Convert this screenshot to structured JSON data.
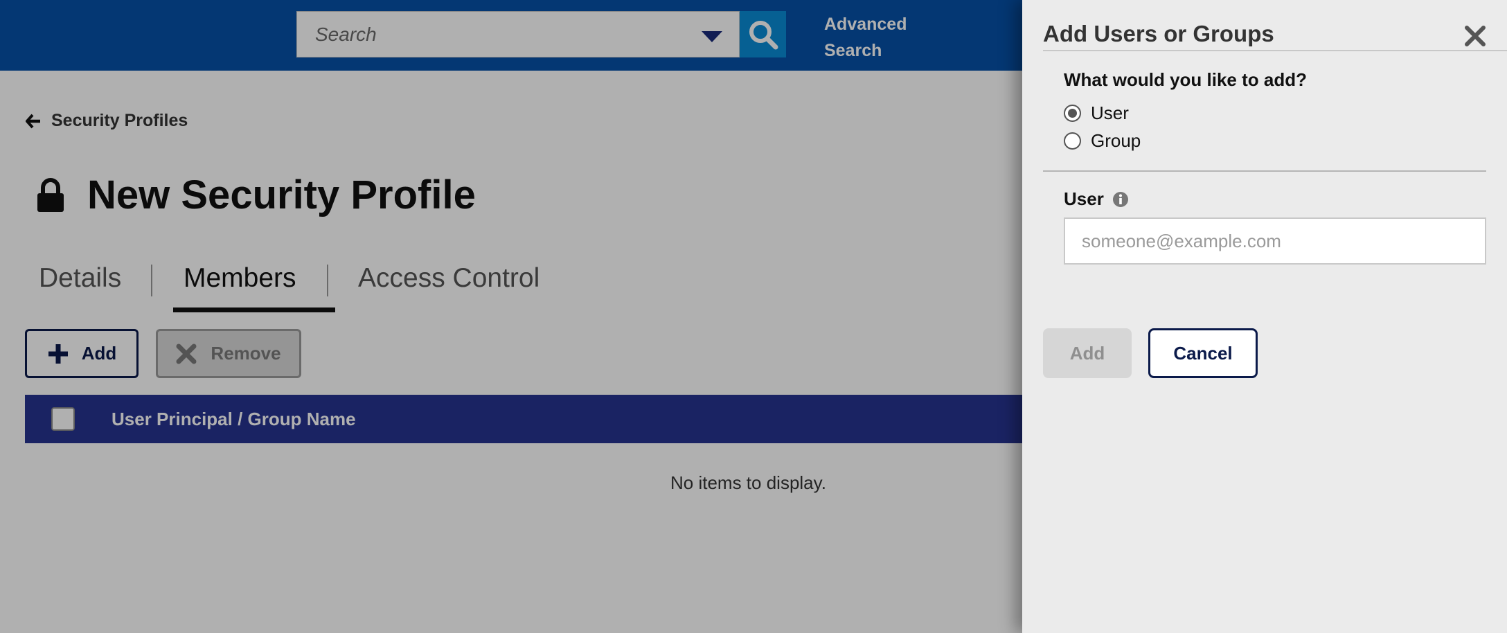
{
  "header": {
    "search_placeholder": "Search",
    "advanced_search_line1": "Advanced",
    "advanced_search_line2": "Search"
  },
  "breadcrumb": {
    "label": "Security Profiles"
  },
  "page": {
    "title": "New Security Profile"
  },
  "tabs": [
    {
      "label": "Details",
      "active": false
    },
    {
      "label": "Members",
      "active": true
    },
    {
      "label": "Access Control",
      "active": false
    }
  ],
  "toolbar": {
    "add_label": "Add",
    "remove_label": "Remove"
  },
  "table": {
    "columns": [
      "User Principal / Group Name"
    ],
    "empty_message": "No items to display."
  },
  "panel": {
    "title": "Add Users or Groups",
    "question": "What would you like to add?",
    "options": [
      {
        "label": "User",
        "selected": true
      },
      {
        "label": "Group",
        "selected": false
      }
    ],
    "user_label": "User",
    "user_placeholder": "someone@example.com",
    "add_label": "Add",
    "cancel_label": "Cancel"
  },
  "icons": {
    "search": "search-icon",
    "dropdown": "chevron-down-icon",
    "back": "arrow-left-icon",
    "lock": "lock-icon",
    "plus": "plus-icon",
    "remove": "x-icon",
    "close": "close-icon",
    "info": "info-icon"
  },
  "colors": {
    "header_bg": "#0650a7",
    "search_button": "#0a8bd6",
    "table_header": "#273390",
    "primary_dark": "#0b1a4a"
  }
}
